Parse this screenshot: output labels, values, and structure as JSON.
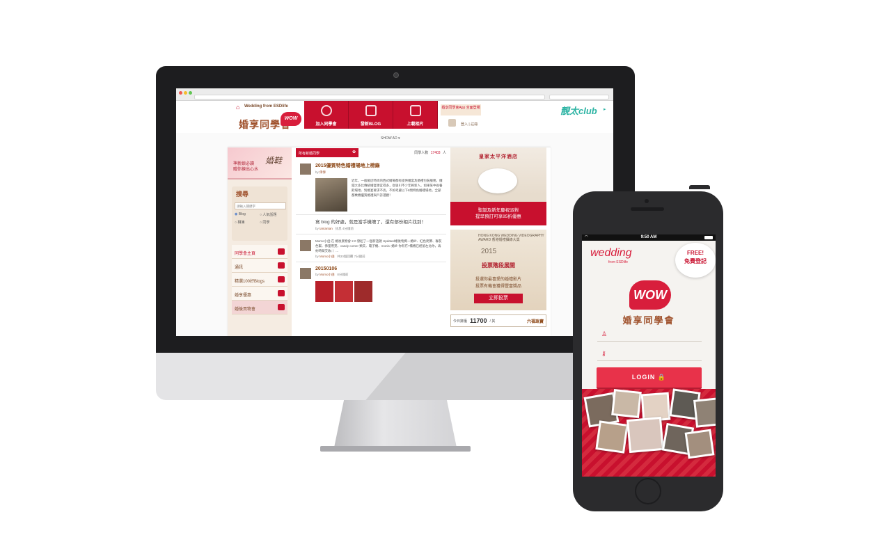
{
  "desktop": {
    "header": {
      "brand_small": "Wedding from ESDlife",
      "logo_text": "婚享同學會",
      "logo_badge": "WOW",
      "nav": [
        {
          "label": "加入同學會",
          "icon": "check-circle-icon"
        },
        {
          "label": "發新BLOG",
          "icon": "pen-icon"
        },
        {
          "label": "上載相片",
          "icon": "photo-upload-icon"
        }
      ],
      "app_promo": "婚享同學會App 全面登場",
      "login_links": "登入 | 註冊",
      "club_logo": "靚太club",
      "show_ad": "SHOW AD ▾"
    },
    "left_ad": {
      "line1": "準新娘必讀",
      "line2": "贈你揀出心水",
      "line3": "婚鞋"
    },
    "search": {
      "title": "搜尋",
      "placeholder": "請輸入關鍵字",
      "options": [
        {
          "label": "Blog",
          "checked": true
        },
        {
          "label": "人氣話題",
          "checked": false
        },
        {
          "label": "相簿",
          "checked": false
        },
        {
          "label": "同學",
          "checked": false
        }
      ]
    },
    "side_menu": [
      {
        "label": "同學會主頁",
        "icon": "home-icon"
      },
      {
        "label": "通訊",
        "icon": "mail-icon"
      },
      {
        "label": "精選100好Blogs",
        "icon": "badge-icon"
      },
      {
        "label": "婚享優惠",
        "icon": "gift-icon"
      },
      {
        "label": "婚後買物會",
        "icon": "heart-icon"
      }
    ],
    "feed": {
      "tab_label": "所有新婚同學",
      "count_label": "同學人數",
      "count_value": "17403",
      "count_unit": "人",
      "posts": [
        {
          "title": "2015優質特色婚禮場地上榜錄",
          "by_label": "by",
          "author": "偉偉",
          "excerpt": "近年，一般飯店時尚的西式婚場都有提供婚宴及婚禮包裝服務，價錢大多比傳統婚宴便宜得多，從吸引不少年輕新人。如果某中長餐飲場地、對婚宴要求不高，不如考慮以下8間特色婚禮場地，全部都乘機優質婚禮與戶誌證觀！"
        },
        {
          "text": "寫 blog 的好處，就是當手機壞了，還有部份相片找到！",
          "by_label": "by",
          "author": "tantantan",
          "meta": "訊息  4分鐘前"
        },
        {
          "text": "Momo小函 在 婚後買物會 2.0 發起了一個新話題 Updated婚後物資一婚紗、紅色爬饗、聯友色幫、佛量用苑、candy corner 類夫、電子機、monis: 婚紗 你有冇?備機已經留左比你，再約時間交收：）...",
          "by_label": "by",
          "author": "Momo小函",
          "meta": "共30個回覆   7分鐘前"
        },
        {
          "title": "20150106",
          "by_label": "by",
          "author": "Momo小函",
          "meta": "8分鐘前"
        }
      ]
    },
    "right_ads": {
      "hotel": {
        "name": "皇家太平洋酒店",
        "line1": "聖誕及新年慶祝派對",
        "line2": "提早預訂可享85折優惠"
      },
      "hkwva": {
        "header": "HONG KONG WEDDING VIDEOGRAPHY AWARD 香港婚禮攝錄大獎",
        "year": "2015",
        "stage": "投票階段展開",
        "desc1": "投選你最喜愛的婚禮影片",
        "desc2": "投票有機會獲得豐富獎品",
        "button": "立即投票"
      },
      "counter": {
        "label": "今日錄獲",
        "value": "11700",
        "unit": "/ 其",
        "brand": "六福珠寶"
      }
    }
  },
  "mobile": {
    "time": "9:50 AM",
    "logo": "wedding",
    "logo_sub": "from ESDlife",
    "free_line1": "FREE!",
    "free_line2": "免費登記",
    "badge": "WOW",
    "title": "婚享同學會",
    "username_icon": "user-icon",
    "password_icon": "key-icon",
    "login_label": "LOGIN 🔒"
  },
  "colors": {
    "brand_red": "#c8102e",
    "brand_brown": "#a0522d",
    "club_teal": "#2bb3a3"
  }
}
